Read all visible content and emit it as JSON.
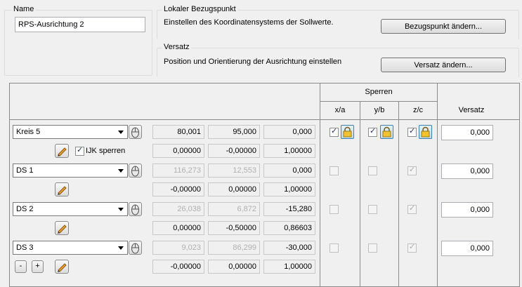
{
  "name_group": {
    "label": "Name",
    "value": "RPS-Ausrichtung 2"
  },
  "reference": {
    "label": "Lokaler Bezugspunkt",
    "description": "Einstellen des Koordinatensystems der Sollwerte.",
    "button": "Bezugspunkt ändern..."
  },
  "offset": {
    "label": "Versatz",
    "description": "Position und Orientierung der Ausrichtung einstellen",
    "button": "Versatz ändern..."
  },
  "grid": {
    "headers": {
      "lock_group": "Sperren",
      "x": "x/a",
      "y": "y/b",
      "z": "z/c",
      "offset": "Versatz"
    },
    "rows": [
      {
        "feature": "Kreis  5",
        "values": [
          "80,001",
          "95,000",
          "0,000"
        ],
        "vector": [
          "0,00000",
          "-0,00000",
          "1,00000"
        ],
        "versatz": "0,000",
        "ijk_label": "IJK sperren"
      },
      {
        "feature": "DS 1",
        "values": [
          "116,273",
          "12,553",
          "0,000"
        ],
        "vector": [
          "-0,00000",
          "0,00000",
          "1,00000"
        ],
        "versatz": "0,000"
      },
      {
        "feature": "DS 2",
        "values": [
          "26,038",
          "6,872",
          "-15,280"
        ],
        "vector": [
          "0,00000",
          "-0,50000",
          "0,86603"
        ],
        "versatz": "0,000"
      },
      {
        "feature": "DS 3",
        "values": [
          "9,023",
          "86,299",
          "-30,000"
        ],
        "vector": [
          "-0,00000",
          "0,00000",
          "1,00000"
        ],
        "versatz": "0,000"
      }
    ],
    "minus_label": "-",
    "plus_label": "+"
  },
  "colors": {
    "accent_lock": "#f2c230",
    "window_bg": "#f0f0f0"
  }
}
